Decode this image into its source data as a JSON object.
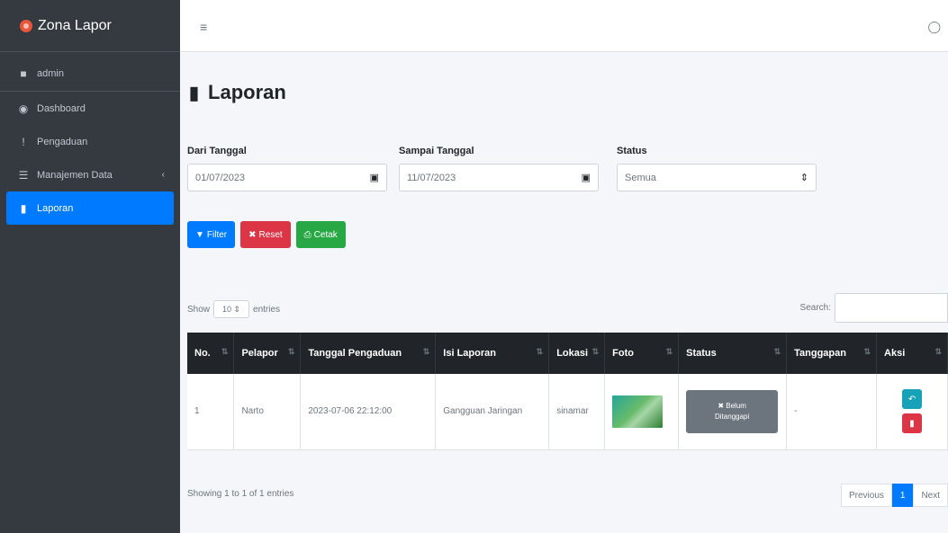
{
  "brand": {
    "name": "Zona Lapor"
  },
  "user": {
    "name": "admin"
  },
  "sidebar": {
    "items": [
      {
        "label": "Dashboard",
        "icon": "dashboard-icon"
      },
      {
        "label": "Pengaduan",
        "icon": "exclamation-icon"
      },
      {
        "label": "Manajemen Data",
        "icon": "list-icon"
      },
      {
        "label": "Laporan",
        "icon": "file-icon"
      }
    ]
  },
  "page": {
    "title": "Laporan"
  },
  "filters": {
    "dari_label": "Dari Tanggal",
    "dari_value": "01/07/2023",
    "sampai_label": "Sampai Tanggal",
    "sampai_value": "11/07/2023",
    "status_label": "Status",
    "status_value": "Semua"
  },
  "buttons": {
    "filter": "Filter",
    "reset": "Reset",
    "cetak": "Cetak"
  },
  "table_controls": {
    "show": "Show",
    "entries_value": "10",
    "entries": "entries",
    "search_label": "Search:"
  },
  "table": {
    "headers": [
      "No.",
      "Pelapor",
      "Tanggal Pengaduan",
      "Isi Laporan",
      "Lokasi",
      "Foto",
      "Status",
      "Tanggapan",
      "Aksi"
    ],
    "rows": [
      {
        "no": "1",
        "pelapor": "Narto",
        "tanggal": "2023-07-06 22:12:00",
        "isi": "Gangguan Jaringan",
        "lokasi": "sinamar",
        "status_line1": "Belum",
        "status_line2": "Ditanggapi",
        "tanggapan": "-"
      }
    ]
  },
  "footer": {
    "info": "Showing 1 to 1 of 1 entries",
    "previous": "Previous",
    "page": "1",
    "next": "Next"
  },
  "colors": {
    "sidebar": "#343a40",
    "primary": "#007bff",
    "danger": "#dc3545",
    "success": "#28a745",
    "info": "#17a2b8",
    "secondary": "#6c757d",
    "table_header": "#212529"
  }
}
